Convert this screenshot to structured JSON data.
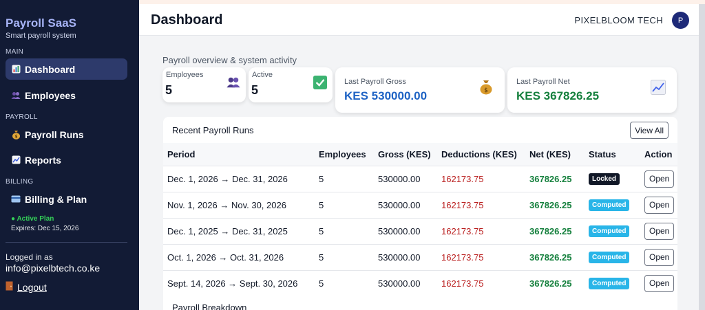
{
  "sidebar": {
    "brand": "Payroll SaaS",
    "tagline": "Smart payroll system",
    "sections": {
      "main": "MAIN",
      "payroll": "PAYROLL",
      "billing": "BILLING"
    },
    "items": [
      {
        "label": "Dashboard",
        "icon": "chart-icon"
      },
      {
        "label": "Employees",
        "icon": "people-icon"
      },
      {
        "label": "Payroll Runs",
        "icon": "money-bag-icon"
      },
      {
        "label": "Reports",
        "icon": "trend-icon"
      },
      {
        "label": "Billing & Plan",
        "icon": "credit-card-icon"
      }
    ],
    "plan_status": "● Active Plan",
    "plan_expiry": "Expires: Dec 15, 2026",
    "logged_in_label": "Logged in as",
    "logged_in_email": "info@pixelbtech.co.ke",
    "logout": "Logout"
  },
  "header": {
    "title": "Dashboard",
    "company": "PIXELBLOOM TECH",
    "avatar_initial": "P"
  },
  "overview": {
    "subtitle": "Payroll overview & system activity",
    "employees_label": "Employees",
    "employees_value": "5",
    "active_label": "Active",
    "active_value": "5",
    "gross_label": "Last Payroll Gross",
    "gross_value": "KES 530000.00",
    "net_label": "Last Payroll Net",
    "net_value": "KES 367826.25"
  },
  "runs": {
    "title": "Recent Payroll Runs",
    "view_all": "View All",
    "columns": [
      "Period",
      "Employees",
      "Gross (KES)",
      "Deductions (KES)",
      "Net (KES)",
      "Status",
      "Action"
    ],
    "rows": [
      {
        "period": "Dec. 1, 2026 → Dec. 31, 2026",
        "employees": "5",
        "gross": "530000.00",
        "deductions": "162173.75",
        "net": "367826.25",
        "status": "Locked",
        "action": "Open"
      },
      {
        "period": "Nov. 1, 2026 → Nov. 30, 2026",
        "employees": "5",
        "gross": "530000.00",
        "deductions": "162173.75",
        "net": "367826.25",
        "status": "Computed",
        "action": "Open"
      },
      {
        "period": "Dec. 1, 2025 → Dec. 31, 2025",
        "employees": "5",
        "gross": "530000.00",
        "deductions": "162173.75",
        "net": "367826.25",
        "status": "Computed",
        "action": "Open"
      },
      {
        "period": "Oct. 1, 2026 → Oct. 31, 2026",
        "employees": "5",
        "gross": "530000.00",
        "deductions": "162173.75",
        "net": "367826.25",
        "status": "Computed",
        "action": "Open"
      },
      {
        "period": "Sept. 14, 2026 → Sept. 30, 2026",
        "employees": "5",
        "gross": "530000.00",
        "deductions": "162173.75",
        "net": "367826.25",
        "status": "Computed",
        "action": "Open"
      }
    ]
  },
  "breakdown": {
    "title": "Payroll Breakdown"
  },
  "colors": {
    "sidebar_bg": "#121b35",
    "brand": "#a7b4f7",
    "gross_blue": "#1f63c4",
    "net_green": "#15803d",
    "deduction_red": "#b91c1c",
    "badge_locked": "#111827",
    "badge_computed": "#29b5e8"
  }
}
